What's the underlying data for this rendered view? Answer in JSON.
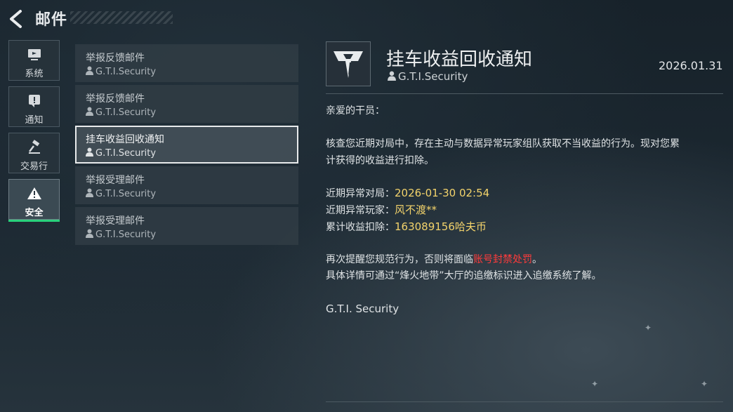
{
  "header": {
    "title": "邮件"
  },
  "categories": [
    {
      "label": "系统",
      "icon": "monitor-icon"
    },
    {
      "label": "通知",
      "icon": "exclamation-icon"
    },
    {
      "label": "交易行",
      "icon": "gavel-icon"
    },
    {
      "label": "安全",
      "icon": "warning-icon",
      "active": true
    }
  ],
  "mails": [
    {
      "subject": "举报反馈邮件",
      "sender": "G.T.I.Security"
    },
    {
      "subject": "举报反馈邮件",
      "sender": "G.T.I.Security"
    },
    {
      "subject": "挂车收益回收通知",
      "sender": "G.T.I.Security",
      "selected": true
    },
    {
      "subject": "举报受理邮件",
      "sender": "G.T.I.Security"
    },
    {
      "subject": "举报受理邮件",
      "sender": "G.T.I.Security"
    }
  ],
  "detail": {
    "title": "挂车收益回收通知",
    "sender": "G.T.I.Security",
    "date": "2026.01.31",
    "greeting": "亲爱的干员：",
    "paragraph_line1": "核查您近期对局中，存在主动与数据异常玩家组队获取不当收益的行为。现对您累",
    "paragraph_line2": "计获得的收益进行扣除。",
    "match_label": "近期异常对局：",
    "match_value": "2026-01-30 02:54",
    "player_label": "近期异常玩家：",
    "player_value": "风不渡**",
    "deduct_label": "累计收益扣除：",
    "deduct_value": "163089156哈夫币",
    "warning_prefix": "再次提醒您规范行为，否则将面临",
    "warning_red": "账号封禁处罚",
    "warning_suffix": "。",
    "info_line": "具体详情可通过“烽火地带”大厅的追缴标识进入追缴系统了解。",
    "signature": "G.T.I. Security"
  },
  "colors": {
    "accent_green": "#29d17b",
    "highlight_yellow": "#f3d36b",
    "alert_red": "#ff3b3b"
  }
}
